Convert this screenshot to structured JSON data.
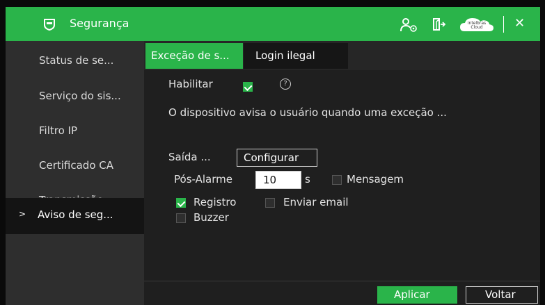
{
  "titlebar": {
    "title": "Segurança",
    "cloud_brand": "intelbras",
    "cloud_label": "Cloud",
    "icons": [
      "shield-icon",
      "user-settings-icon",
      "logout-icon",
      "cloud-icon",
      "close-icon"
    ],
    "close_glyph": "✕"
  },
  "sidebar": {
    "items": [
      {
        "label": "Status de se..."
      },
      {
        "label": "Serviço do sis..."
      },
      {
        "label": "Filtro IP"
      },
      {
        "label": "Certificado CA"
      },
      {
        "label": "Transmissão..."
      },
      {
        "label": "Aviso de seg...",
        "active": true
      }
    ],
    "active_marker": ">"
  },
  "tabs": [
    {
      "label": "Exceção de s...",
      "active": true
    },
    {
      "label": "Login ilegal",
      "active": false
    }
  ],
  "form": {
    "enable_label": "Habilitar",
    "enable_checked": true,
    "help_glyph": "?",
    "description": "O dispositivo avisa o usuário quando uma exceção ...",
    "output_label": "Saída ...",
    "configure_button": "Configurar",
    "post_alarm_label": "Pós-Alarme",
    "post_alarm_value": "10",
    "post_alarm_unit": "s",
    "message_label": "Mensagem",
    "message_checked": false,
    "record_label": "Registro",
    "record_checked": true,
    "email_label": "Enviar email",
    "email_checked": false,
    "buzzer_label": "Buzzer",
    "buzzer_checked": false
  },
  "footer": {
    "apply_button": "Aplicar",
    "back_button": "Voltar"
  },
  "colors": {
    "accent": "#2ab44a",
    "background": "#1f1f1f",
    "sidebar": "#2e2e2e"
  }
}
